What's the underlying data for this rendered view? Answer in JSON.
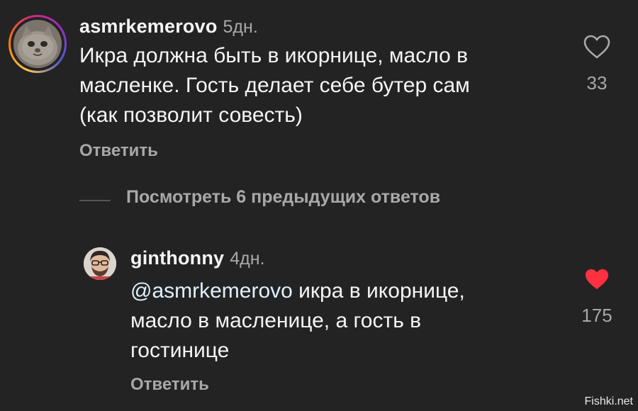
{
  "comment": {
    "username": "asmrkemerovo",
    "time": "5дн.",
    "text_lines": [
      "Икра должна быть в икорнице, масло в",
      "масленке. Гость делает себе бутер сам",
      "(как позволит совесть)"
    ],
    "reply_label": "Ответить",
    "like_count": "33",
    "liked": false,
    "avatar_icon": "cat-avatar-icon"
  },
  "view_replies": {
    "label": "Посмотреть 6 предыдущих ответов"
  },
  "reply": {
    "username": "ginthonny",
    "time": "4дн.",
    "mention": "@asmrkemerovo",
    "text_first": " икра в икорнице,",
    "text_lines": [
      "масло в масленице, а гость в",
      "гостинице"
    ],
    "reply_label": "Ответить",
    "like_count": "175",
    "liked": true,
    "like_color": "#ff3040",
    "avatar_icon": "man-with-glasses-avatar-icon"
  },
  "watermark": "Fishki.net"
}
